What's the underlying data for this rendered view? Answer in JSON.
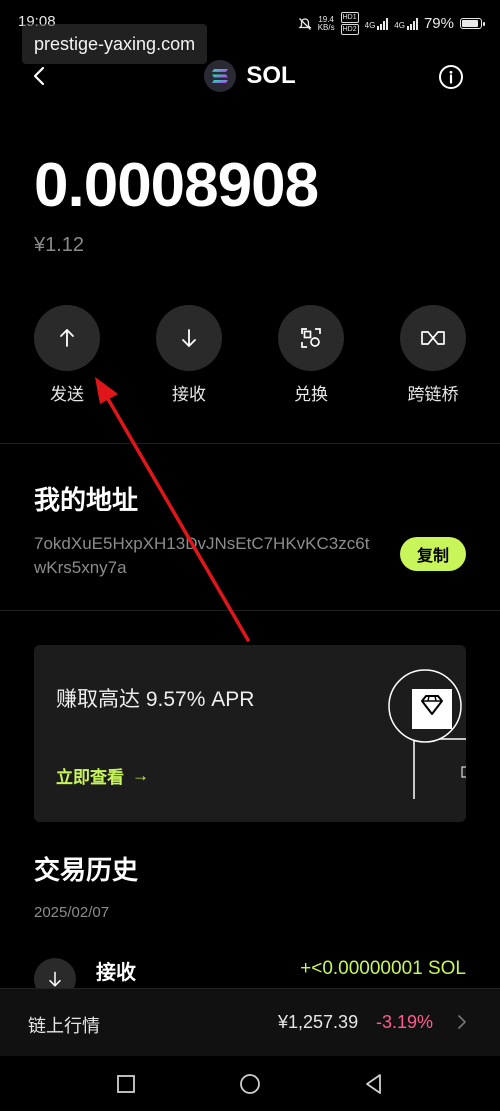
{
  "status_bar": {
    "time": "19:08",
    "net_speed": "19.4",
    "net_unit": "KB/s",
    "hd1": "HD1",
    "hd2": "HD2",
    "sig1": "4G",
    "sig2": "4G",
    "battery": "79%",
    "battery_level": 0.79
  },
  "overlay": {
    "url": "prestige-yaxing.com"
  },
  "header": {
    "title": "SOL",
    "back_icon": "chevron-left-icon",
    "info_icon": "info-icon"
  },
  "balance": {
    "amount": "0.0008908",
    "fiat": "¥1.12"
  },
  "actions": [
    {
      "label": "发送",
      "icon": "arrow-up-icon"
    },
    {
      "label": "接收",
      "icon": "arrow-down-icon"
    },
    {
      "label": "兑换",
      "icon": "swap-icon"
    },
    {
      "label": "跨链桥",
      "icon": "bridge-icon"
    }
  ],
  "address": {
    "title": "我的地址",
    "value": "7okdXuE5HxpXH13DvJNsEtC7HKvKC3zc6twKrs5xny7a",
    "copy_label": "复制"
  },
  "promo": {
    "text": "赚取高达 9.57% APR",
    "link": "立即查看",
    "link_arrow": "→"
  },
  "history": {
    "title": "交易历史",
    "date": "2025/02/07",
    "items": [
      {
        "label": "接收",
        "amount": "+<0.00000001 SOL"
      }
    ]
  },
  "market": {
    "label": "链上行情",
    "price": "¥1,257.39",
    "change": "-3.19%"
  },
  "colors": {
    "accent": "#c8f55a",
    "negative": "#ff5c8d",
    "annotation": "#e0161b"
  }
}
